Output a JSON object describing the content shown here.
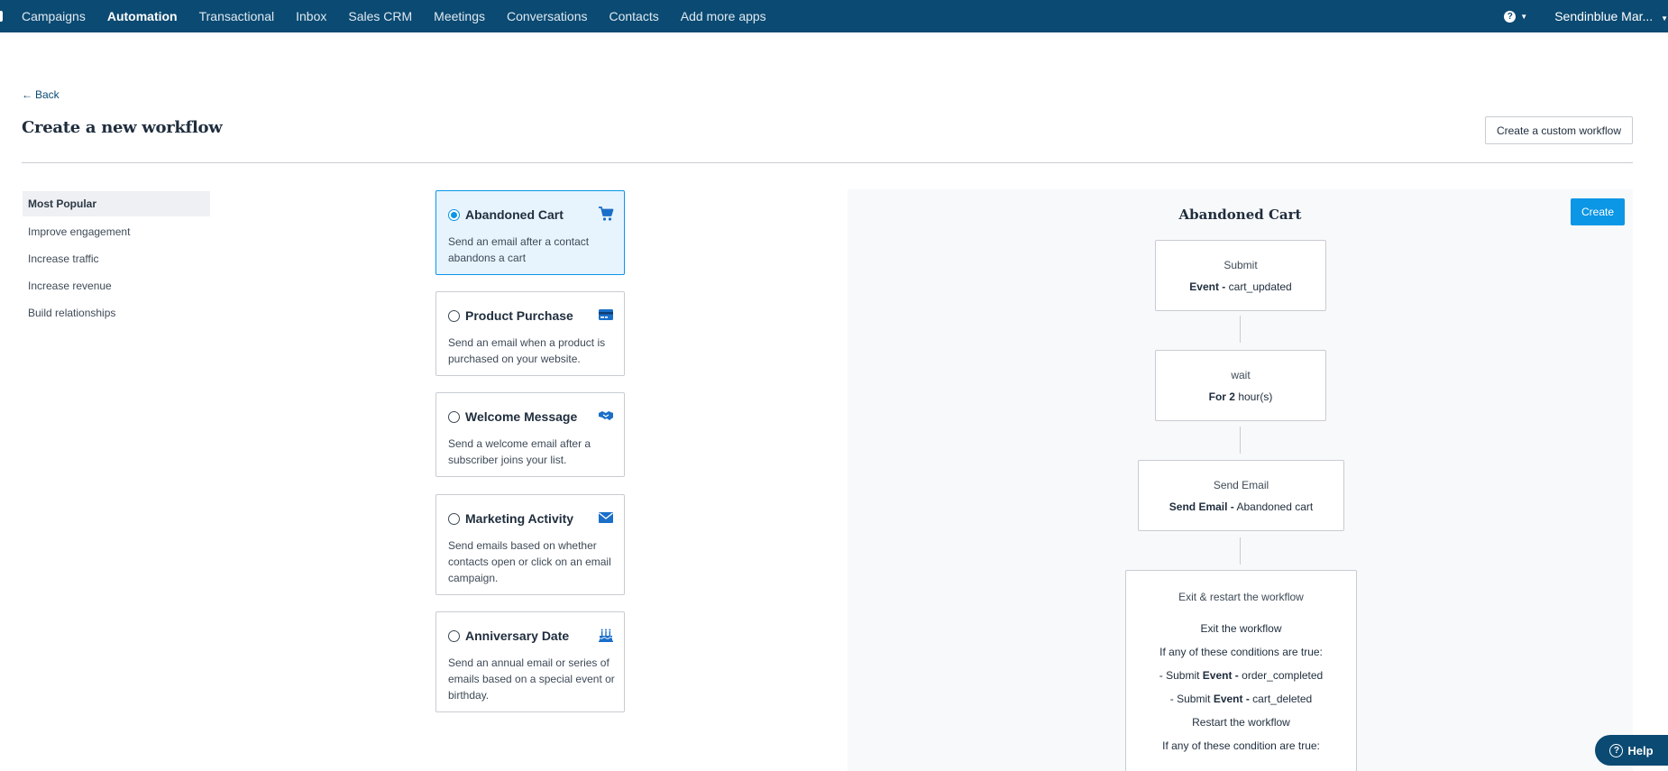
{
  "topnav": {
    "items": [
      "Campaigns",
      "Automation",
      "Transactional",
      "Inbox",
      "Sales CRM",
      "Meetings",
      "Conversations",
      "Contacts",
      "Add more apps"
    ],
    "active": "Automation",
    "help_icon": "question-circle-icon",
    "account": "Sendinblue Mar..."
  },
  "header": {
    "back_label": "Back",
    "title": "Create a new workflow",
    "custom_workflow_button": "Create a custom workflow"
  },
  "categories": [
    "Most Popular",
    "Improve engagement",
    "Increase traffic",
    "Increase revenue",
    "Build relationships"
  ],
  "templates": [
    {
      "title": "Abandoned Cart",
      "description": "Send an email after a contact abandons a cart",
      "icon": "shopping-cart-icon",
      "selected": true
    },
    {
      "title": "Product Purchase",
      "description": "Send an email when a product is purchased on your website.",
      "icon": "credit-card-icon",
      "selected": false
    },
    {
      "title": "Welcome Message",
      "description": "Send a welcome email after a subscriber joins your list.",
      "icon": "handshake-icon",
      "selected": false
    },
    {
      "title": "Marketing Activity",
      "description": "Send emails based on whether contacts open or click on an email campaign.",
      "icon": "envelope-icon",
      "selected": false
    },
    {
      "title": "Anniversary Date",
      "description": "Send an annual email or series of emails based on a special event or birthday.",
      "icon": "birthday-cake-icon",
      "selected": false
    }
  ],
  "preview": {
    "title": "Abandoned Cart",
    "create_button": "Create",
    "nodes": {
      "submit": {
        "head": "Submit",
        "key": "Event -",
        "value": "cart_updated"
      },
      "wait": {
        "head": "wait",
        "key": "For 2",
        "value": "hour(s)"
      },
      "send": {
        "head": "Send Email",
        "key": "Send Email -",
        "value": "Abandoned cart"
      },
      "exit": {
        "head": "Exit & restart the workflow",
        "exit_label": "Exit the workflow",
        "exit_condition": "If any of these conditions are true:",
        "cond1_prefix": "- Submit",
        "cond1_key": "Event -",
        "cond1_value": "order_completed",
        "cond2_prefix": "- Submit",
        "cond2_key": "Event -",
        "cond2_value": "cart_deleted",
        "restart_label": "Restart the workflow",
        "restart_condition": "If any of these condition are true:"
      }
    }
  },
  "colors": {
    "nav_bg": "#0b4a72",
    "accent": "#0b96e6",
    "selected_card_bg": "#e7f4fe",
    "preview_bg": "#f8f9fa"
  },
  "help_widget": {
    "label": "Help"
  }
}
